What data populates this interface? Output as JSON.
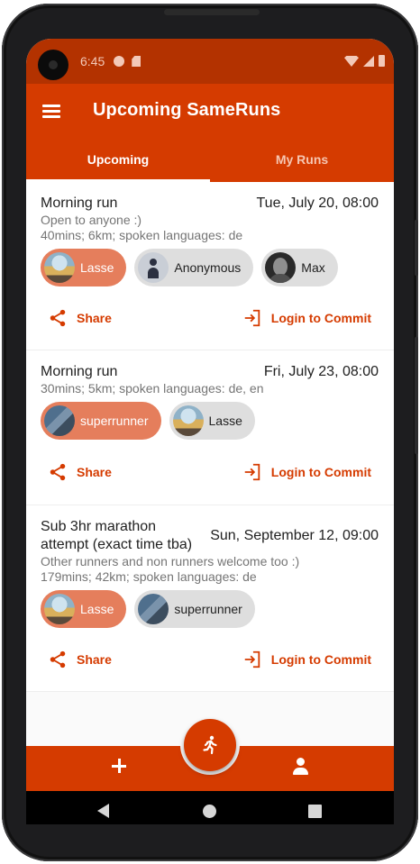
{
  "status_bar": {
    "time": "6:45"
  },
  "app_bar": {
    "title": "Upcoming SameRuns"
  },
  "tabs": [
    {
      "label": "Upcoming",
      "active": true
    },
    {
      "label": "My Runs",
      "active": false
    }
  ],
  "runs": [
    {
      "title": "Morning run",
      "date": "Tue, July 20, 08:00",
      "description": "Open to anyone :)",
      "details": "40mins; 6km; spoken languages: de",
      "participants": [
        {
          "name": "Lasse",
          "owner": true,
          "avatar": "van-photo"
        },
        {
          "name": "Anonymous",
          "owner": false,
          "avatar": "anonymous-runner"
        },
        {
          "name": "Max",
          "owner": false,
          "avatar": "portrait-photo"
        }
      ],
      "share_label": "Share",
      "commit_label": "Login to Commit"
    },
    {
      "title": "Morning run",
      "date": "Fri, July 23, 08:00",
      "description": "",
      "details": "30mins; 5km; spoken languages: de, en",
      "participants": [
        {
          "name": "superrunner",
          "owner": true,
          "avatar": "rock-photo"
        },
        {
          "name": "Lasse",
          "owner": false,
          "avatar": "van-photo"
        }
      ],
      "share_label": "Share",
      "commit_label": "Login to Commit"
    },
    {
      "title": "Sub 3hr marathon attempt (exact time tba)",
      "date": "Sun, September 12, 09:00",
      "description": "Other runners and non runners welcome too :)",
      "details": "179mins; 42km; spoken languages: de",
      "participants": [
        {
          "name": "Lasse",
          "owner": true,
          "avatar": "van-photo"
        },
        {
          "name": "superrunner",
          "owner": false,
          "avatar": "rock-photo"
        }
      ],
      "share_label": "Share",
      "commit_label": "Login to Commit"
    }
  ],
  "bottom_bar": {
    "left_icon": "add-icon",
    "center_icon": "runner-icon",
    "right_icon": "person-icon"
  },
  "colors": {
    "primary": "#d53b00",
    "owner_chip": "#e57e5c",
    "chip": "#dedede",
    "status_bar": "#b33200"
  }
}
